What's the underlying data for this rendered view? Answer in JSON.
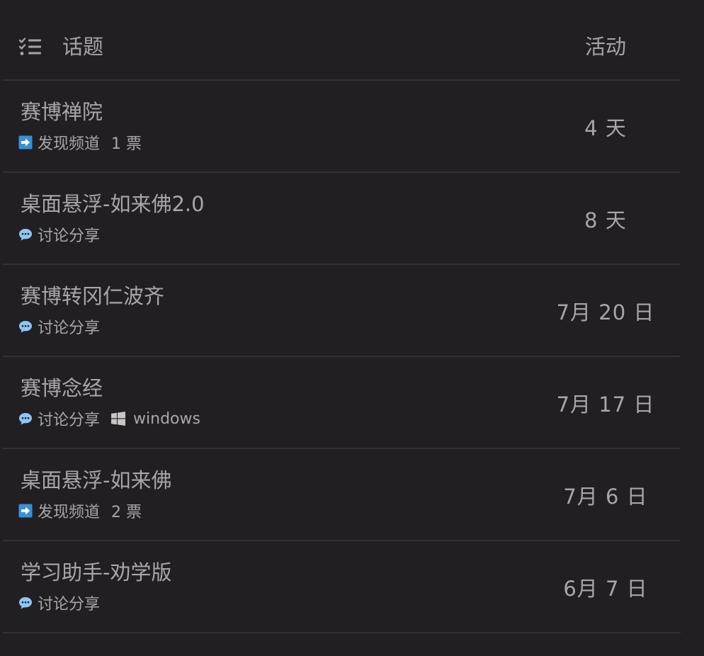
{
  "header": {
    "topic_label": "话题",
    "activity_label": "活动"
  },
  "topics": [
    {
      "title": "赛博禅院",
      "category": "发现频道",
      "category_icon": "arrow-right-icon",
      "votes": "1 票",
      "tag": "",
      "activity": "4 天"
    },
    {
      "title": "桌面悬浮-如来佛2.0",
      "category": "讨论分享",
      "category_icon": "speech-bubble-icon",
      "votes": "",
      "tag": "",
      "activity": "8 天"
    },
    {
      "title": "赛博转冈仁波齐",
      "category": "讨论分享",
      "category_icon": "speech-bubble-icon",
      "votes": "",
      "tag": "",
      "activity": "7月 20 日"
    },
    {
      "title": "赛博念经",
      "category": "讨论分享",
      "category_icon": "speech-bubble-icon",
      "votes": "",
      "tag": "windows",
      "activity": "7月 17 日"
    },
    {
      "title": "桌面悬浮-如来佛",
      "category": "发现频道",
      "category_icon": "arrow-right-icon",
      "votes": "2 票",
      "tag": "",
      "activity": "7月 6 日"
    },
    {
      "title": "学习助手-劝学版",
      "category": "讨论分享",
      "category_icon": "speech-bubble-icon",
      "votes": "",
      "tag": "",
      "activity": "6月 7 日"
    }
  ],
  "colors": {
    "background": "#221f22",
    "divider": "#333034",
    "text": "#a9a5a8",
    "arrow_icon_bg": "#3b8fd6",
    "bubble_icon": "#8fc6f5"
  }
}
